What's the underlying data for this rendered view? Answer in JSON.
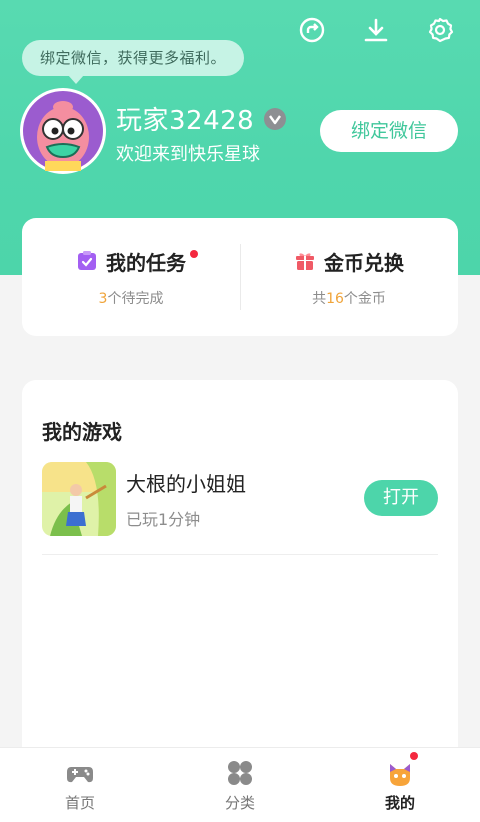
{
  "header": {
    "bubble_text": "绑定微信，获得更多福利。",
    "username": "玩家32428",
    "welcome": "欢迎来到快乐星球",
    "bind_button": "绑定微信",
    "icons": [
      "share-icon",
      "download-icon",
      "settings-icon"
    ]
  },
  "quick_actions": {
    "tasks": {
      "title": "我的任务",
      "count": "3",
      "suffix": "个待完成",
      "has_dot": true
    },
    "exchange": {
      "title": "金币兑换",
      "prefix": "共",
      "count": "16",
      "suffix": "个金币"
    }
  },
  "games": {
    "title": "我的游戏",
    "items": [
      {
        "name": "大根的小姐姐",
        "played": "已玩1分钟",
        "button": "打开"
      }
    ]
  },
  "nav": {
    "items": [
      {
        "label": "首页",
        "icon": "gamepad-icon",
        "active": false
      },
      {
        "label": "分类",
        "icon": "grid-icon",
        "active": false
      },
      {
        "label": "我的",
        "icon": "mine-icon",
        "active": true,
        "has_dot": true
      }
    ]
  },
  "colors": {
    "accent": "#4dd5aa",
    "task_purple": "#a35ff2",
    "exchange_red": "#f05a66",
    "highlight": "#f0a43a",
    "dot": "#f4283f"
  }
}
